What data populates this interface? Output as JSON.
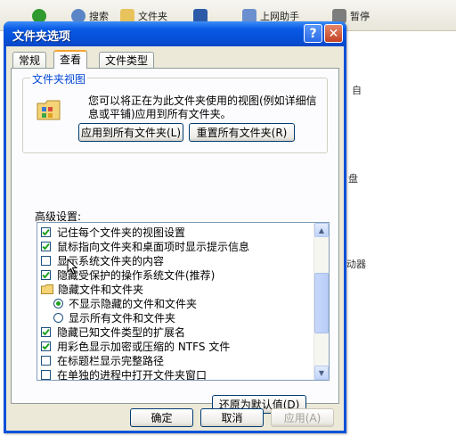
{
  "background": {
    "toolbar": {
      "back_label": "",
      "search_label": "搜索",
      "folders_label": "文件夹",
      "history_label": "上网助手",
      "extra_label": "暂停"
    },
    "side_texts": [
      "自",
      "盘",
      "动器"
    ]
  },
  "dialog": {
    "title": "文件夹选项",
    "help_symbol": "?",
    "close_symbol": "✕",
    "tabs": [
      "常规",
      "查看",
      "文件类型"
    ],
    "active_tab": "查看",
    "folder_view": {
      "title": "文件夹视图",
      "description": "您可以将正在为此文件夹使用的视图(例如详细信息或平铺)应用到所有文件夹。",
      "apply_all_button": "应用到所有文件夹(L)",
      "reset_all_button": "重置所有文件夹(R)"
    },
    "advanced_label": "高级设置:",
    "advanced_items": [
      {
        "type": "checkbox",
        "label": "记住每个文件夹的视图设置",
        "checked": true
      },
      {
        "type": "checkbox",
        "label": "鼠标指向文件夹和桌面项时显示提示信息",
        "checked": true
      },
      {
        "type": "checkbox",
        "label": "显示系统文件夹的内容",
        "checked": false
      },
      {
        "type": "checkbox",
        "label": "隐藏受保护的操作系统文件(推荐)",
        "checked": true
      },
      {
        "type": "folder",
        "label": "隐藏文件和文件夹"
      },
      {
        "type": "radio",
        "label": "不显示隐藏的文件和文件夹",
        "selected": true
      },
      {
        "type": "radio",
        "label": "显示所有文件和文件夹",
        "selected": false
      },
      {
        "type": "checkbox",
        "label": "隐藏已知文件类型的扩展名",
        "checked": true
      },
      {
        "type": "checkbox",
        "label": "用彩色显示加密或压缩的 NTFS 文件",
        "checked": true
      },
      {
        "type": "checkbox",
        "label": "在标题栏显示完整路径",
        "checked": false
      },
      {
        "type": "checkbox",
        "label": "在单独的进程中打开文件夹窗口",
        "checked": false
      }
    ],
    "restore_defaults_button": "还原为默认值(D)",
    "ok_button": "确定",
    "cancel_button": "取消",
    "apply_button": "应用(A)",
    "colors": {
      "titlebar": "#0550d8",
      "face": "#ece9d8",
      "tab_accent": "#f6a32e",
      "check": "#21a121"
    }
  }
}
